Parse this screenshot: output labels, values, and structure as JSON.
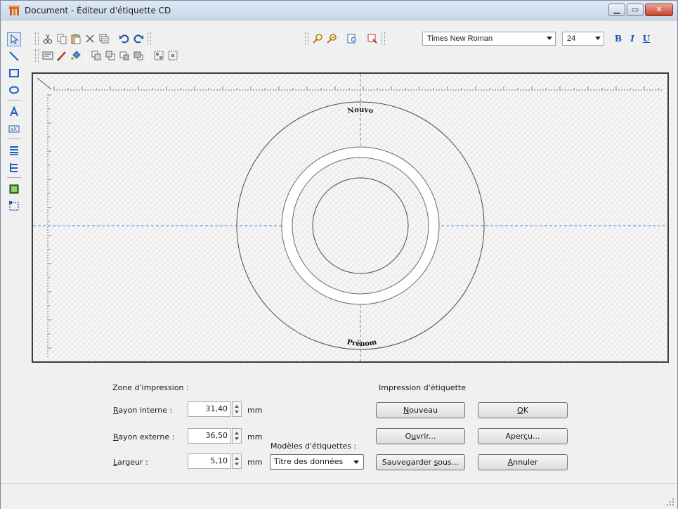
{
  "window": {
    "title": "Document - Éditeur d'étiquette CD"
  },
  "toolbar": {
    "font_name": "Times New Roman",
    "font_size": "24",
    "bold_label": "B",
    "italic_label": "I",
    "underline_label": "U"
  },
  "canvas": {
    "top_text": "Nouvo",
    "bottom_text": "Prénom"
  },
  "print_zone": {
    "heading": "Zone d'impression :",
    "inner_radius": {
      "label_underlined": "R",
      "label_rest": "ayon interne :",
      "value": "31,40",
      "unit": "mm"
    },
    "outer_radius": {
      "label_underlined": "R",
      "label_rest": "ayon externe :",
      "value": "36,50",
      "unit": "mm"
    },
    "width": {
      "label_underlined": "L",
      "label_rest": "argeur :",
      "value": "5,10",
      "unit": "mm"
    }
  },
  "templates": {
    "label": "Modèles d'étiquettes :",
    "selected": "Titre des données"
  },
  "label_print": {
    "heading": "Impression d'étiquette",
    "new_button": {
      "underlined": "N",
      "rest": "ouveau"
    },
    "open_button": {
      "before": "O",
      "underlined": "u",
      "rest": "vrir..."
    },
    "save_button": {
      "before": "Sauvegarder ",
      "underlined": "s",
      "rest": "ous..."
    },
    "ok_button": {
      "underlined": "O",
      "rest": "K"
    },
    "preview_button": {
      "before": "Aper",
      "underlined": "ç",
      "rest": "u..."
    },
    "cancel_button": {
      "underlined": "A",
      "rest": "nnuler"
    }
  }
}
